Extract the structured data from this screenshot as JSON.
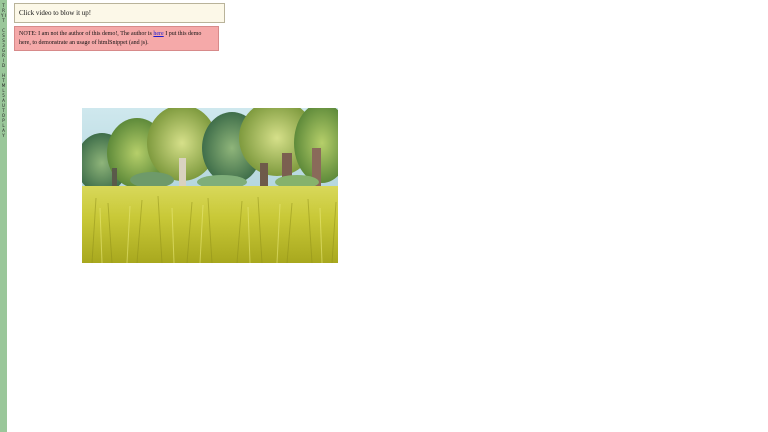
{
  "sidebar": {
    "letters_top": "T R Y I T",
    "letters_mid": "C S S 3 G R I D",
    "letters_low": "H T M L 5 A U T O P L A Y"
  },
  "hint": {
    "text": "Click video to blow it up!"
  },
  "note": {
    "text_before": "NOTE: I am not the author of this demo!, The author is ",
    "link_text": "here",
    "text_after": " I put this demo here, to demonstrate an usage of htmlSnippet (and js)."
  },
  "video": {
    "label": "video-player"
  },
  "colors": {
    "sidebar": "#9ac79a",
    "hint_bg": "#fcf8e8",
    "note_bg": "#f5a9a9",
    "link": "#1a1acc"
  }
}
